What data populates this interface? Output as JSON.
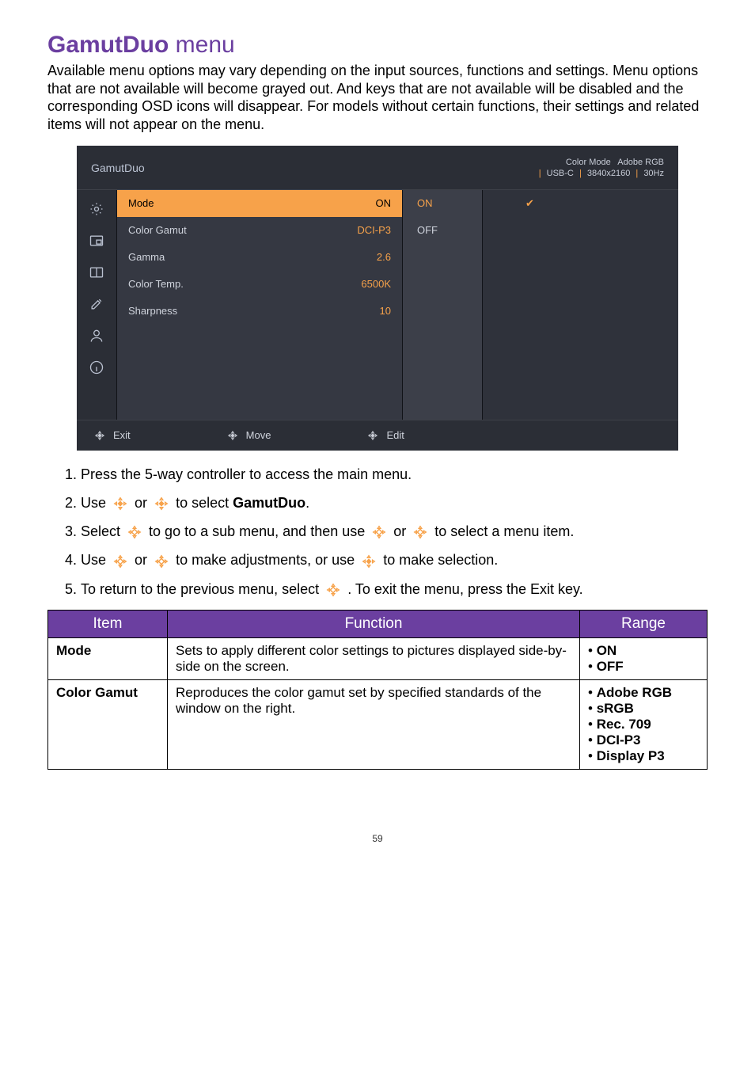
{
  "heading": {
    "bold": "GamutDuo",
    "rest": " menu"
  },
  "intro": "Available menu options may vary depending on the input sources, functions and settings. Menu options that are not available will become grayed out. And keys that are not available will be disabled and the corresponding OSD icons will disappear. For models without certain functions, their settings and related items will not appear on the menu.",
  "osd": {
    "title": "GamutDuo",
    "status": {
      "line1_left": "Color Mode",
      "line1_right": "Adobe RGB",
      "line2_input": "USB-C",
      "line2_res": "3840x2160",
      "line2_hz": "30Hz"
    },
    "col1": [
      {
        "label": "Mode",
        "value": "ON",
        "selected": true
      },
      {
        "label": "Color Gamut",
        "value": "DCI-P3"
      },
      {
        "label": "Gamma",
        "value": "2.6"
      },
      {
        "label": "Color Temp.",
        "value": "6500K"
      },
      {
        "label": "Sharpness",
        "value": "10"
      }
    ],
    "col2": [
      {
        "label": "ON",
        "highlight": true
      },
      {
        "label": "OFF"
      }
    ],
    "col3_check_row": 0,
    "footer": {
      "exit": "Exit",
      "move": "Move",
      "edit": "Edit"
    }
  },
  "steps": {
    "s1": "Press the 5-way controller to access the main menu.",
    "s2_a": "Use ",
    "s2_b": " or ",
    "s2_c": " to select ",
    "s2_target": "GamutDuo",
    "s2_d": ".",
    "s3_a": "Select ",
    "s3_b": " to go to a sub menu, and then use ",
    "s3_c": " or ",
    "s3_d": " to select a menu item.",
    "s4_a": "Use ",
    "s4_b": " or ",
    "s4_c": " to make adjustments, or use ",
    "s4_d": " to make selection.",
    "s5_a": "To return to the previous menu, select ",
    "s5_b": ". To exit the menu, press the Exit key."
  },
  "table": {
    "head": {
      "item": "Item",
      "func": "Function",
      "range": "Range"
    },
    "rows": [
      {
        "item": "Mode",
        "func": "Sets to apply different color settings to pictures displayed side-by-side on the screen.",
        "range": [
          "ON",
          "OFF"
        ]
      },
      {
        "item": "Color Gamut",
        "func": "Reproduces the color gamut set by specified standards of the window on the right.",
        "range": [
          "Adobe RGB",
          "sRGB",
          "Rec. 709",
          "DCI-P3",
          "Display P3"
        ]
      }
    ]
  },
  "pagenum": "59"
}
